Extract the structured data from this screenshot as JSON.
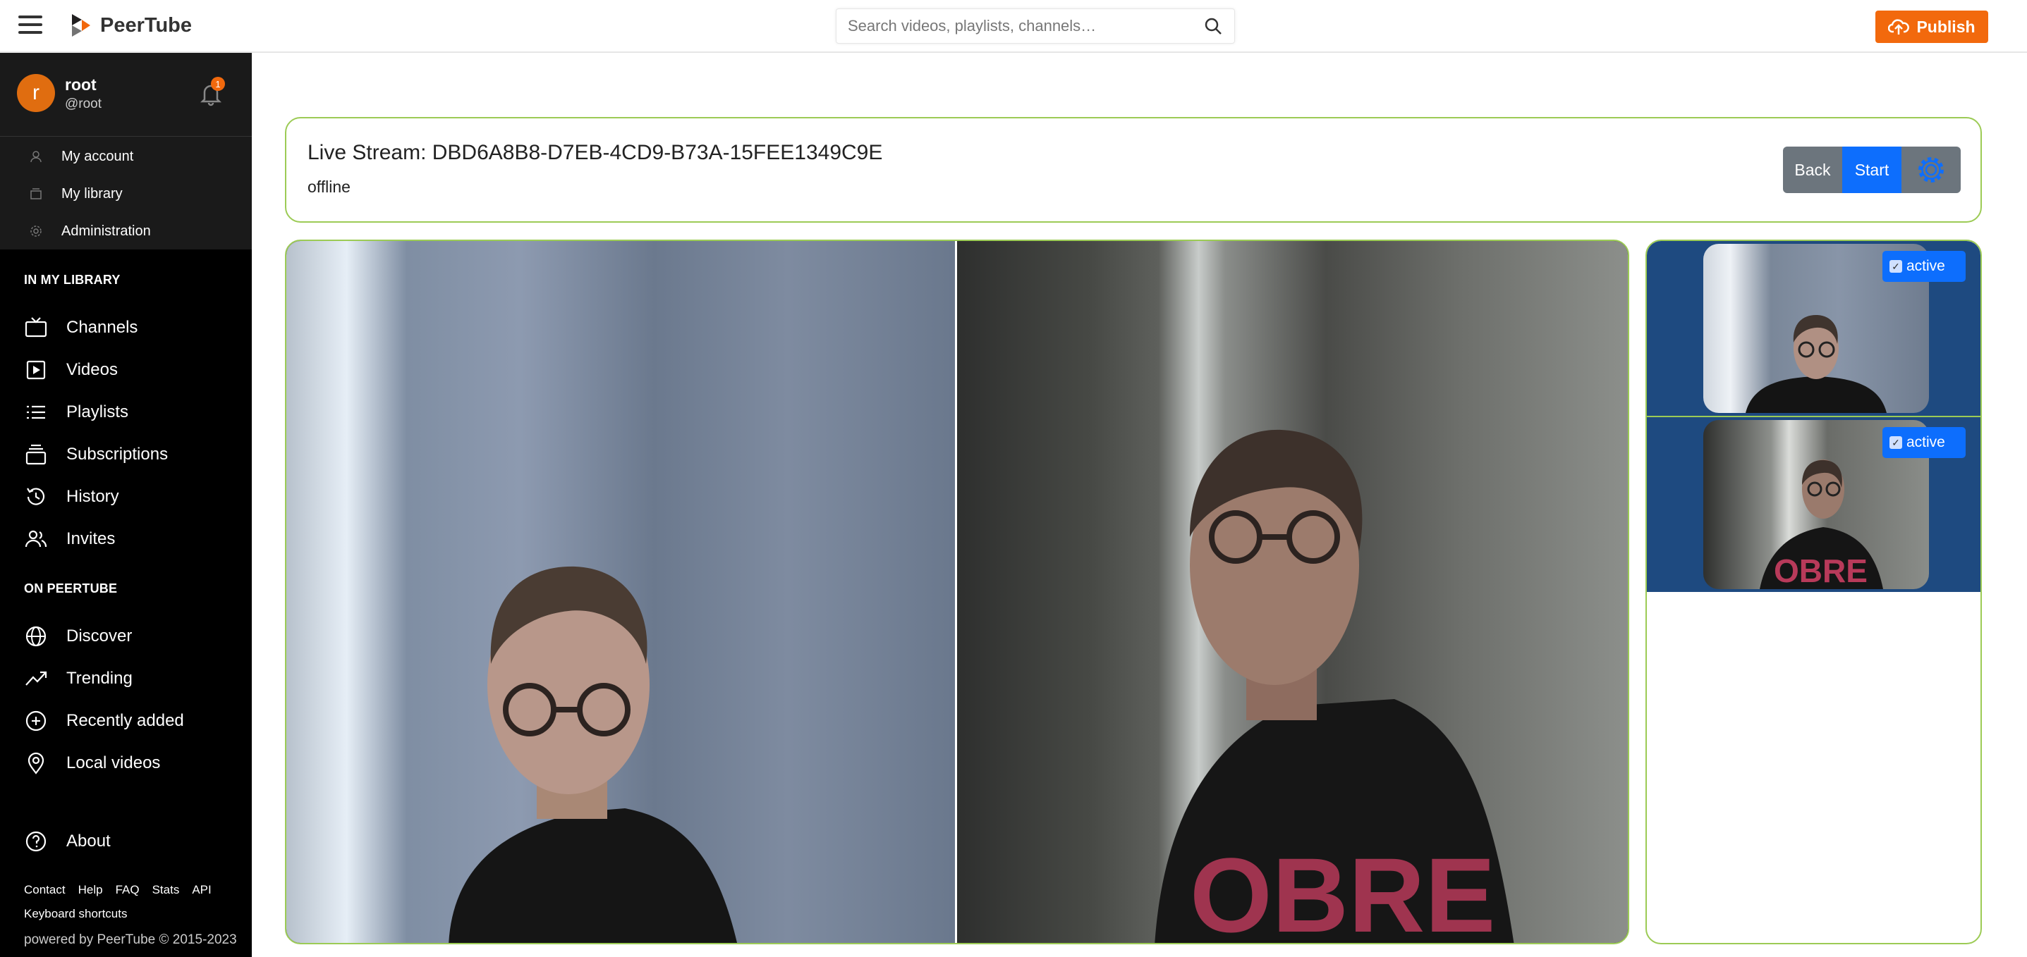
{
  "app": {
    "name": "PeerTube"
  },
  "search": {
    "placeholder": "Search videos, playlists, channels…"
  },
  "header": {
    "publish_label": "Publish"
  },
  "user": {
    "initial": "r",
    "name": "root",
    "handle": "@root",
    "notification_count": "1"
  },
  "user_menu": [
    "My account",
    "My library",
    "Administration"
  ],
  "sidebar": {
    "library_title": "IN MY LIBRARY",
    "library_items": [
      "Channels",
      "Videos",
      "Playlists",
      "Subscriptions",
      "History",
      "Invites"
    ],
    "peertube_title": "ON PEERTUBE",
    "peertube_items": [
      "Discover",
      "Trending",
      "Recently added",
      "Local videos"
    ],
    "about": "About",
    "footer_links": [
      "Contact",
      "Help",
      "FAQ",
      "Stats",
      "API"
    ],
    "shortcuts": "Keyboard shortcuts",
    "powered_by": "powered by PeerTube © 2015-2023"
  },
  "stream": {
    "title": "Live Stream: DBD6A8B8-D7EB-4CD9-B73A-15FEE1349C9E",
    "status": "offline",
    "back_label": "Back",
    "start_label": "Start"
  },
  "sources": [
    {
      "label": "active",
      "checked": true
    },
    {
      "label": "active",
      "checked": true
    }
  ],
  "colors": {
    "accent": "#f2690d",
    "primary": "#0d6efd",
    "secondary": "#6c757d",
    "border": "#9ccb55",
    "source_bg": "#1e4a80"
  }
}
